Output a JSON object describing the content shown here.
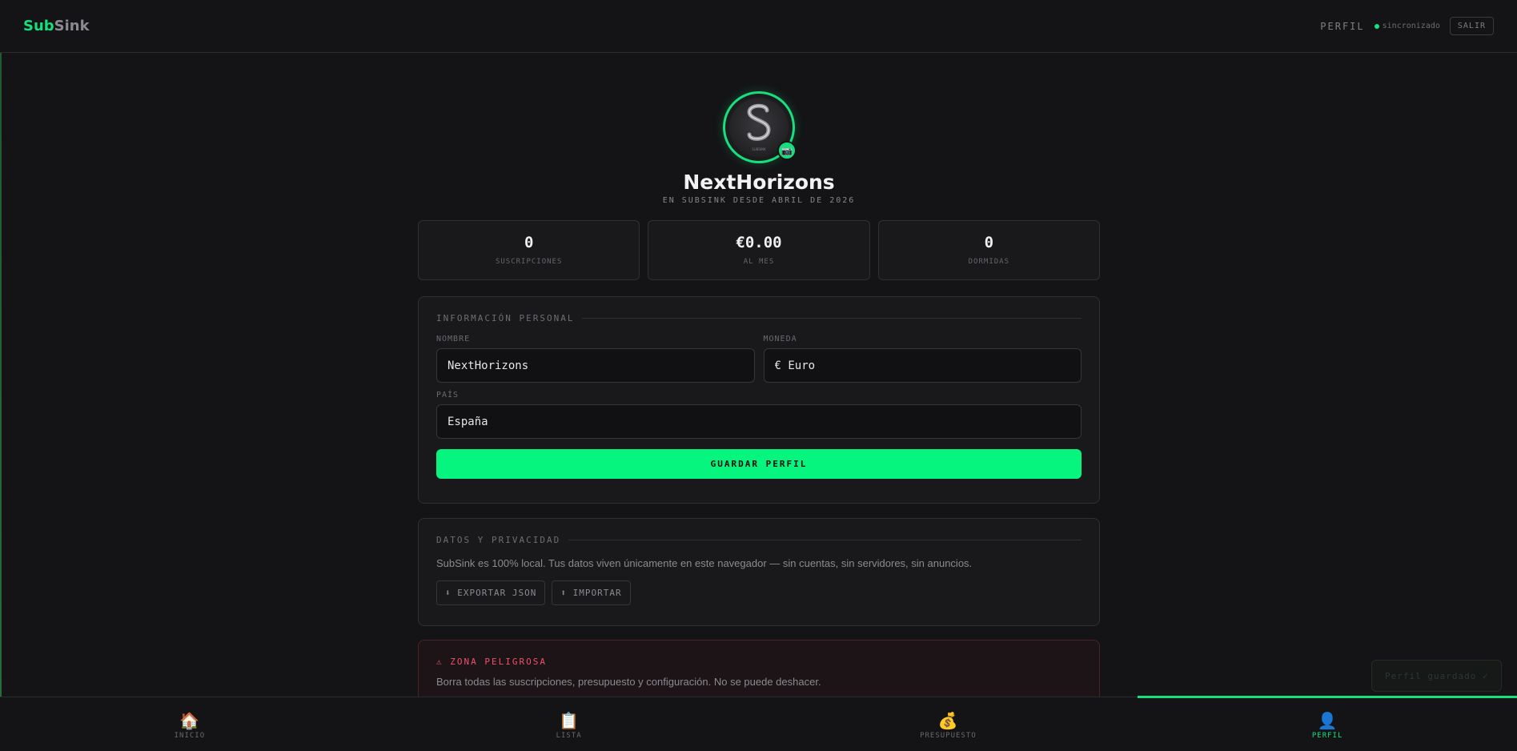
{
  "header": {
    "logo_part1": "Sub",
    "logo_part2": "Sink",
    "page_label": "PERFIL",
    "sync_status": "sincronizado",
    "logout_label": "SALIR"
  },
  "profile": {
    "avatar_text": "SUBSINK",
    "name": "NextHorizons",
    "since": "EN SUBSINK DESDE ABRIL DE 2026"
  },
  "stats": [
    {
      "value": "0",
      "label": "SUSCRIPCIONES"
    },
    {
      "value": "€0.00",
      "label": "AL MES"
    },
    {
      "value": "0",
      "label": "DORMIDAS"
    }
  ],
  "personal": {
    "title": "INFORMACIÓN PERSONAL",
    "name_label": "NOMBRE",
    "name_value": "NextHorizons",
    "currency_label": "MONEDA",
    "currency_value": "€ Euro",
    "country_label": "PAÍS",
    "country_value": "España",
    "save_label": "GUARDAR PERFIL"
  },
  "privacy": {
    "title": "DATOS Y PRIVACIDAD",
    "text": "SubSink es 100% local. Tus datos viven únicamente en este navegador — sin cuentas, sin servidores, sin anuncios.",
    "export_label": "⬇ EXPORTAR JSON",
    "import_label": "⬆ IMPORTAR"
  },
  "danger": {
    "title": "⚠ ZONA PELIGROSA",
    "text": "Borra todas las suscripciones, presupuesto y configuración. No se puede deshacer."
  },
  "toast": {
    "text": "Perfil guardado ✓"
  },
  "nav": [
    {
      "icon": "🏠",
      "label": "INICIO"
    },
    {
      "icon": "📋",
      "label": "LISTA"
    },
    {
      "icon": "💰",
      "label": "PRESUPUESTO"
    },
    {
      "icon": "👤",
      "label": "PERFIL"
    }
  ],
  "colors": {
    "accent": "#17df7e",
    "danger": "#f0506a",
    "background": "#141416"
  }
}
